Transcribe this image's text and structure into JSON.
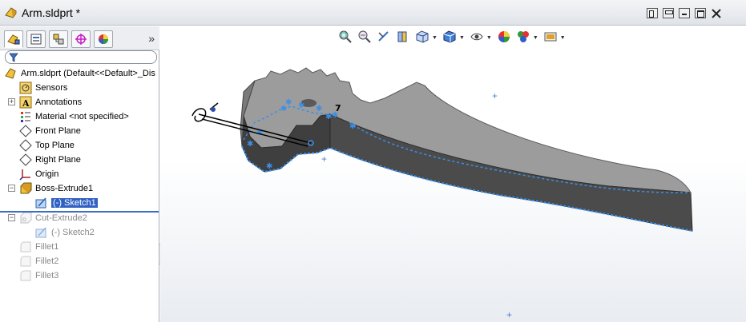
{
  "window": {
    "title": "Arm.sldprt *",
    "controls": [
      "tile-vertical",
      "tile-horizontal",
      "minimize",
      "restore",
      "close"
    ]
  },
  "feature_manager": {
    "tabs": [
      {
        "name": "featuremanager-tab",
        "icon": "feature-tree-icon",
        "active": true
      },
      {
        "name": "propertymanager-tab",
        "icon": "property-icon",
        "active": false
      },
      {
        "name": "configurationmanager-tab",
        "icon": "configuration-icon",
        "active": false
      },
      {
        "name": "dimxpert-tab",
        "icon": "crosshair-icon",
        "active": false
      },
      {
        "name": "display-manager-tab",
        "icon": "appearance-sphere-icon",
        "active": false
      }
    ],
    "more_glyph": "»",
    "filter_placeholder": "",
    "tree": [
      {
        "label": "Arm.sldprt  (Default<<Default>_Dis",
        "icon": "part-icon",
        "indent": 0,
        "expander": "",
        "dim": false
      },
      {
        "label": "Sensors",
        "icon": "sensor-icon",
        "indent": 1,
        "expander": "",
        "dim": false
      },
      {
        "label": "Annotations",
        "icon": "annotation-icon",
        "indent": 1,
        "expander": "+",
        "dim": false
      },
      {
        "label": "Material <not specified>",
        "icon": "material-icon",
        "indent": 1,
        "expander": "",
        "dim": false
      },
      {
        "label": "Front Plane",
        "icon": "plane-icon",
        "indent": 1,
        "expander": "",
        "dim": false
      },
      {
        "label": "Top Plane",
        "icon": "plane-icon",
        "indent": 1,
        "expander": "",
        "dim": false
      },
      {
        "label": "Right Plane",
        "icon": "plane-icon",
        "indent": 1,
        "expander": "",
        "dim": false
      },
      {
        "label": "Origin",
        "icon": "origin-icon",
        "indent": 1,
        "expander": "",
        "dim": false
      },
      {
        "label": "Boss-Extrude1",
        "icon": "extrude-icon",
        "indent": 1,
        "expander": "−",
        "dim": false
      },
      {
        "label": "(-) Sketch1",
        "icon": "sketch-icon",
        "indent": 2,
        "expander": "",
        "dim": false,
        "selected": true
      },
      {
        "label": "Cut-Extrude2",
        "icon": "cut-extrude-icon",
        "indent": 1,
        "expander": "−",
        "dim": true
      },
      {
        "label": "(-) Sketch2",
        "icon": "sketch-icon",
        "indent": 2,
        "expander": "",
        "dim": true
      },
      {
        "label": "Fillet1",
        "icon": "fillet-icon",
        "indent": 1,
        "expander": "",
        "dim": true
      },
      {
        "label": "Fillet2",
        "icon": "fillet-icon",
        "indent": 1,
        "expander": "",
        "dim": true
      },
      {
        "label": "Fillet3",
        "icon": "fillet-icon",
        "indent": 1,
        "expander": "",
        "dim": true
      }
    ]
  },
  "view_toolbar": [
    {
      "name": "zoom-to-fit-button",
      "icon": "zoom-fit-icon",
      "dropdown": false
    },
    {
      "name": "zoom-to-area-button",
      "icon": "zoom-area-icon",
      "dropdown": false
    },
    {
      "name": "previous-view-button",
      "icon": "previous-view-icon",
      "dropdown": false
    },
    {
      "name": "section-view-button",
      "icon": "section-view-icon",
      "dropdown": false
    },
    {
      "name": "view-orientation-button",
      "icon": "view-orientation-icon",
      "dropdown": true
    },
    {
      "name": "display-style-button",
      "icon": "display-style-icon",
      "dropdown": true
    },
    {
      "name": "hide-show-items-button",
      "icon": "hide-show-icon",
      "dropdown": true
    },
    {
      "name": "edit-appearance-button",
      "icon": "appearance-icon",
      "dropdown": false
    },
    {
      "name": "apply-scene-button",
      "icon": "scene-icon",
      "dropdown": true
    },
    {
      "name": "view-settings-button",
      "icon": "view-settings-icon",
      "dropdown": true
    }
  ],
  "colors": {
    "sketch_blue": "#3b8fe8",
    "selection_blue": "#3161c2",
    "model_top": "#9a9a9a",
    "model_side": "#4a4a4a"
  }
}
